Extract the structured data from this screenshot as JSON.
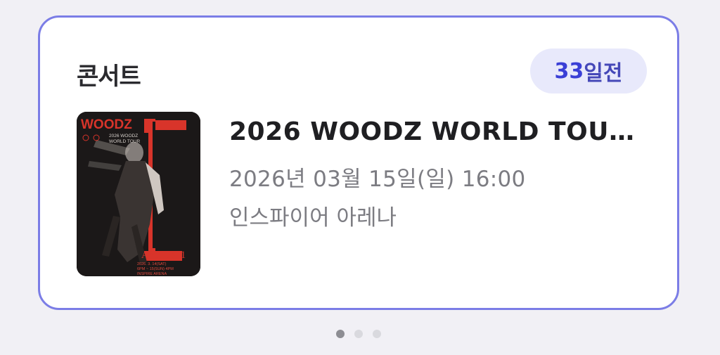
{
  "card": {
    "category": "콘서트",
    "dday": {
      "number": "33",
      "suffix": "일전"
    },
    "event": {
      "title": "2026 WOODZ WORLD TOUR...",
      "datetime": "2026년 03월 15일(일) 16:00",
      "venue": "인스파이어 아레나"
    },
    "poster": {
      "brand": "WOODZ",
      "headline_line1": "2026 WOODZ",
      "headline_line2": "WORLD TOUR",
      "album": "Archive. 1",
      "date_line1": "2026. 3. 14(SAT)",
      "date_line2": "6PM ~ 15(SUN) 4PM",
      "venue_line": "INSPIRE ARENA"
    }
  },
  "pager": {
    "count": 3,
    "active_index": 0
  },
  "colors": {
    "background": "#f1f0f5",
    "card_border": "#7b7de6",
    "badge_bg": "#e8e9fb",
    "badge_text": "#3a3fd6",
    "poster_accent": "#d8342a"
  }
}
